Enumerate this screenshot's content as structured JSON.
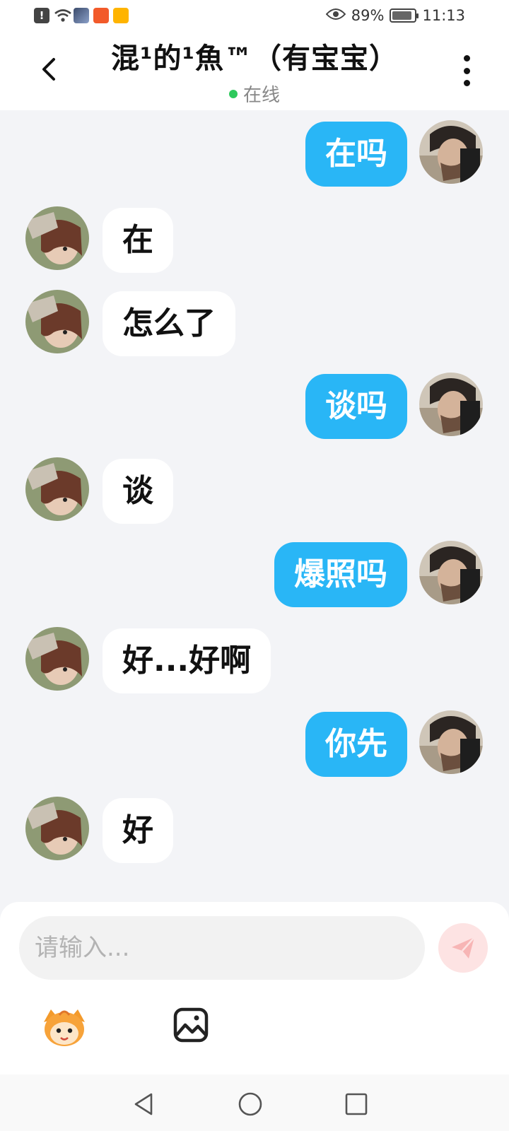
{
  "status_bar": {
    "battery": "89%",
    "battery_level": 0.89,
    "time": "11:13",
    "icons": [
      "alert-icon",
      "wifi-icon",
      "game-app-icon",
      "video-app-icon",
      "vip-app-icon",
      "eye-icon",
      "battery-icon"
    ]
  },
  "header": {
    "title": "混¹的¹魚™（有宝宝）",
    "status": "在线",
    "status_color": "#2ec95c"
  },
  "messages": [
    {
      "side": "right",
      "text": "在吗"
    },
    {
      "side": "left",
      "text": "在"
    },
    {
      "side": "left",
      "text": "怎么了"
    },
    {
      "side": "right",
      "text": "谈吗"
    },
    {
      "side": "left",
      "text": "谈"
    },
    {
      "side": "right",
      "text": "爆照吗"
    },
    {
      "side": "left",
      "text": "好...好啊"
    },
    {
      "side": "right",
      "text": "你先"
    },
    {
      "side": "left",
      "text": "好"
    }
  ],
  "input": {
    "placeholder": "请输入..."
  },
  "colors": {
    "outgoing_bubble": "#29b6f6",
    "incoming_bubble": "#ffffff",
    "background": "#f3f4f7",
    "send_button": "#fde3e3"
  }
}
